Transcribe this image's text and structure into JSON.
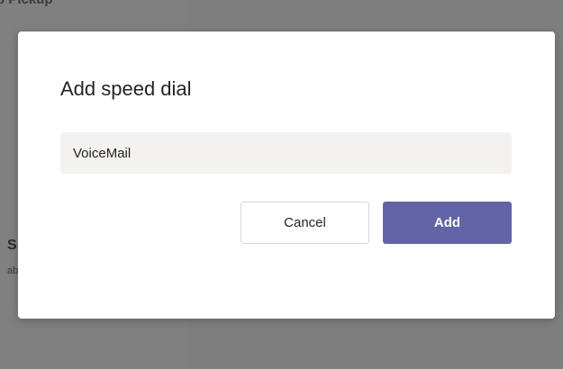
{
  "background": {
    "top_text": "p Pickup",
    "side_title": "S",
    "side_subtitle": "ab"
  },
  "dialog": {
    "title": "Add speed dial",
    "name_input": {
      "value": "VoiceMail",
      "placeholder": ""
    },
    "cancel_label": "Cancel",
    "add_label": "Add"
  },
  "colors": {
    "accent": "#6264a7",
    "input_bg": "#f3f2f1",
    "overlay": "#808080"
  }
}
